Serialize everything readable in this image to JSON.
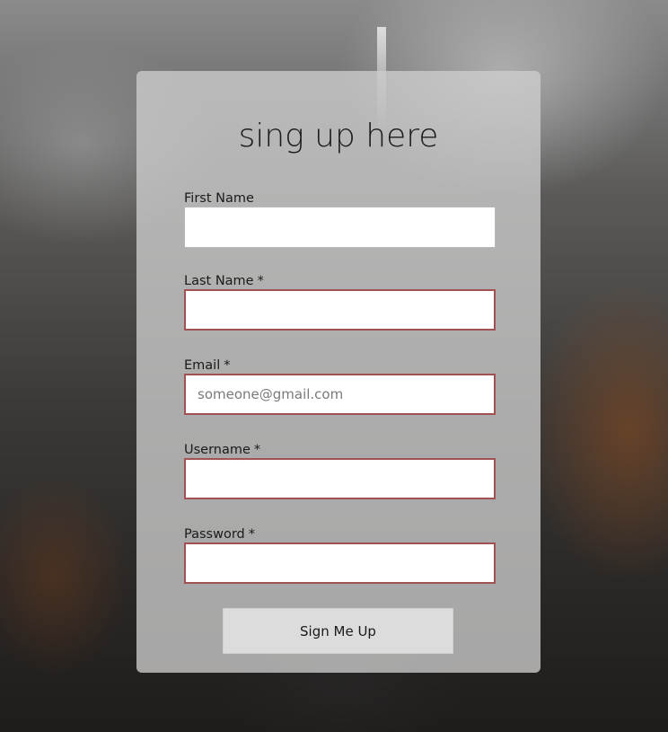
{
  "form": {
    "title": "sing up here",
    "fields": [
      {
        "label": "First Name",
        "required_mark": "",
        "value": "",
        "placeholder": "",
        "required": false
      },
      {
        "label": "Last Name",
        "required_mark": "*",
        "value": "",
        "placeholder": "",
        "required": true
      },
      {
        "label": "Email",
        "required_mark": "*",
        "value": "",
        "placeholder": "someone@gmail.com",
        "required": true
      },
      {
        "label": "Username",
        "required_mark": "*",
        "value": "",
        "placeholder": "",
        "required": true
      },
      {
        "label": "Password",
        "required_mark": "*",
        "value": "",
        "placeholder": "",
        "required": true
      }
    ],
    "submit_label": "Sign Me Up"
  },
  "colors": {
    "required_border": "#a25252",
    "card_background": "rgba(205,205,205,0.78)",
    "button_background": "#dcdcdc"
  }
}
